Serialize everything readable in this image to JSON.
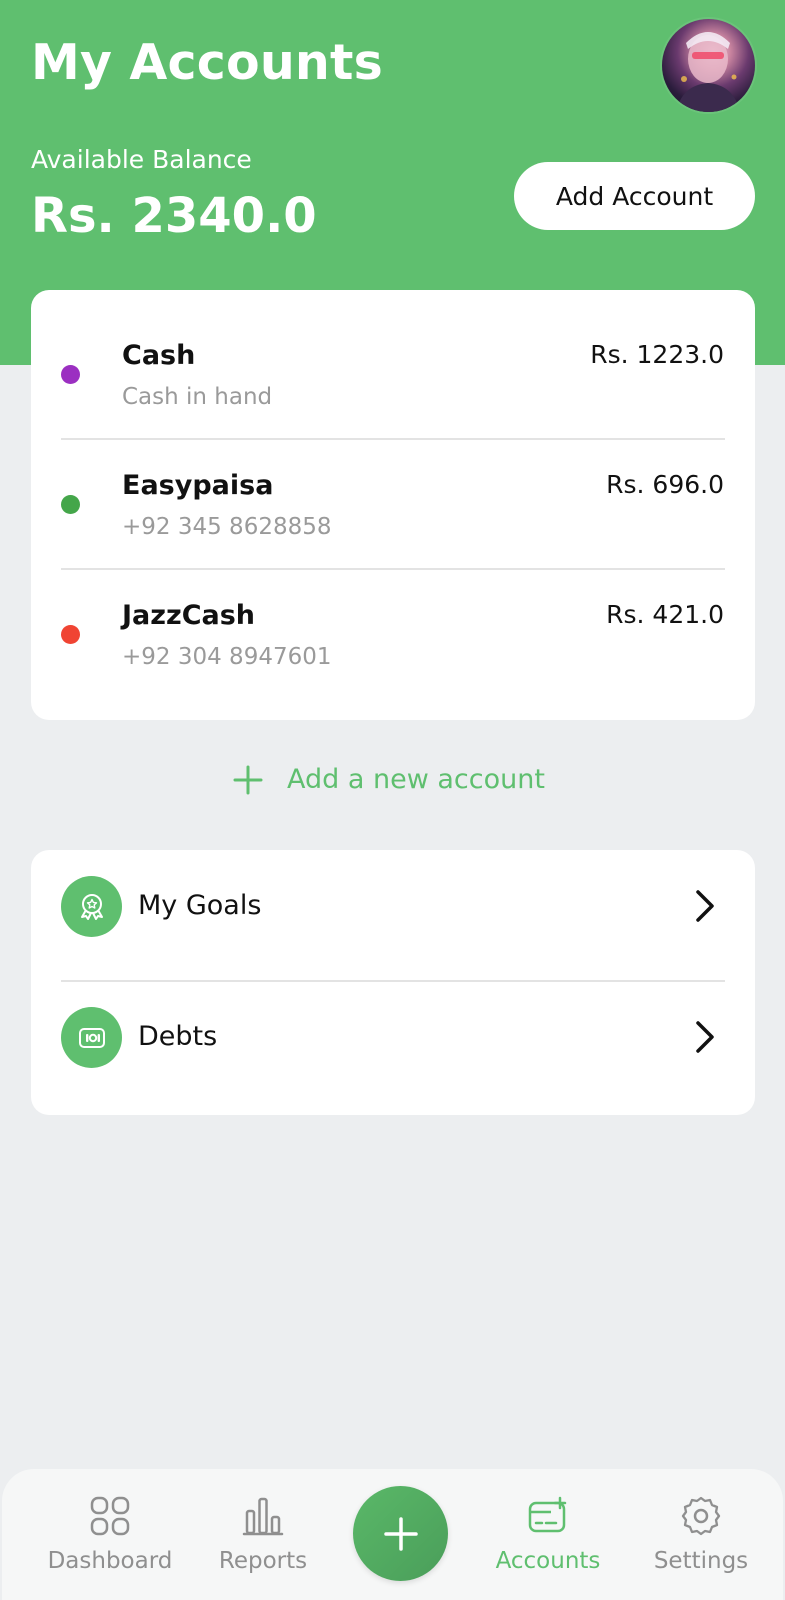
{
  "header": {
    "title": "My Accounts",
    "balance_label": "Available Balance",
    "balance_value": "Rs. 2340.0",
    "add_account_label": "Add Account"
  },
  "accounts": [
    {
      "name": "Cash",
      "subtitle": "Cash in hand",
      "amount": "Rs. 1223.0",
      "dot_color": "#9b2fc1"
    },
    {
      "name": "Easypaisa",
      "subtitle": "+92 345 8628858",
      "amount": "Rs. 696.0",
      "dot_color": "#44a64a"
    },
    {
      "name": "JazzCash",
      "subtitle": "+92 304 8947601",
      "amount": "Rs. 421.0",
      "dot_color": "#f04433"
    }
  ],
  "add_new_account_label": "Add a new account",
  "links": [
    {
      "label": "My Goals",
      "icon": "goal-badge-icon"
    },
    {
      "label": "Debts",
      "icon": "banknote-icon"
    }
  ],
  "nav": {
    "items": [
      {
        "label": "Dashboard",
        "icon": "grid-icon",
        "active": false
      },
      {
        "label": "Reports",
        "icon": "bar-chart-icon",
        "active": false
      },
      {
        "label": "Accounts",
        "icon": "card-add-icon",
        "active": true
      },
      {
        "label": "Settings",
        "icon": "gear-icon",
        "active": false
      }
    ],
    "fab_icon": "plus-icon"
  },
  "colors": {
    "brand_green": "#5fbf6f",
    "background": "#eceef0",
    "muted_text": "#9a9a9a"
  }
}
